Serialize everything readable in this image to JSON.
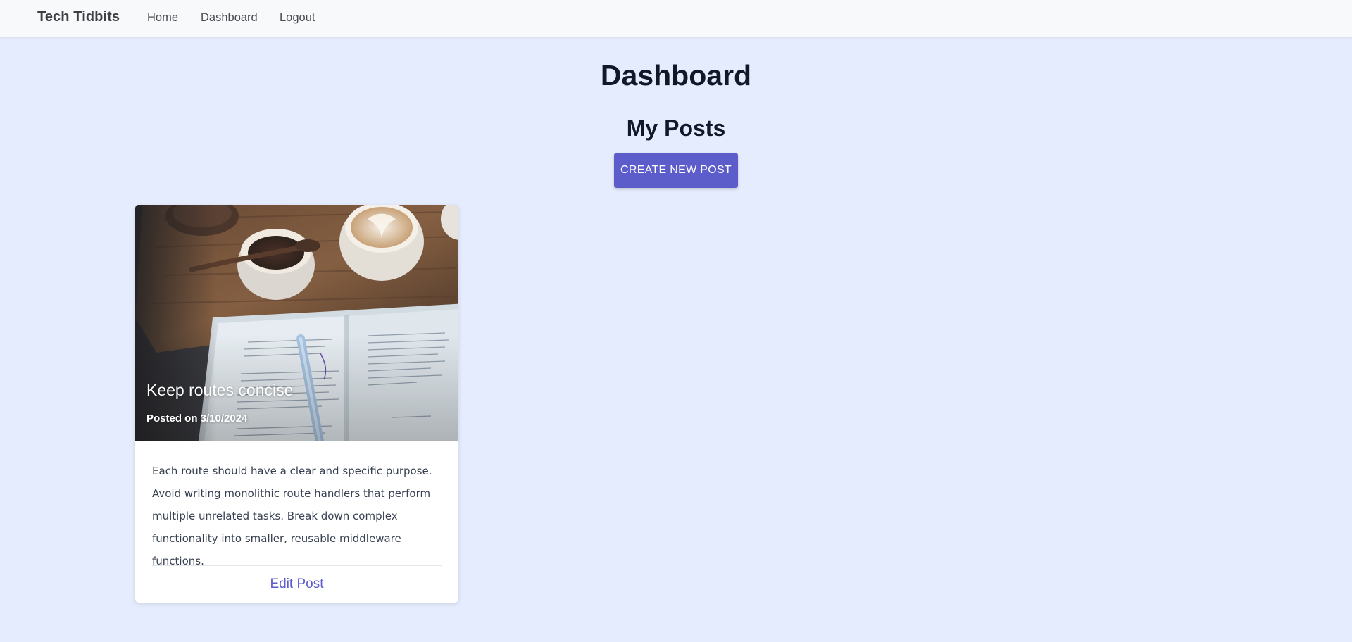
{
  "nav": {
    "brand": "Tech Tidbits",
    "links": [
      {
        "label": "Home"
      },
      {
        "label": "Dashboard"
      },
      {
        "label": "Logout"
      }
    ]
  },
  "page": {
    "title": "Dashboard",
    "section_title": "My Posts",
    "create_button_label": "CREATE NEW POST"
  },
  "posts": [
    {
      "title": "Keep routes concise",
      "date": "Posted on 3/10/2024",
      "body": "Each route should have a clear and specific purpose. Avoid writing monolithic route handlers that perform multiple unrelated tasks. Break down complex functionality into smaller, reusable middleware functions.",
      "edit_label": "Edit Post"
    }
  ],
  "colors": {
    "page_background": "#e5ecfd",
    "navbar_background": "#f8f9fb",
    "accent": "#5c5ccb",
    "heading_text": "#111827"
  }
}
